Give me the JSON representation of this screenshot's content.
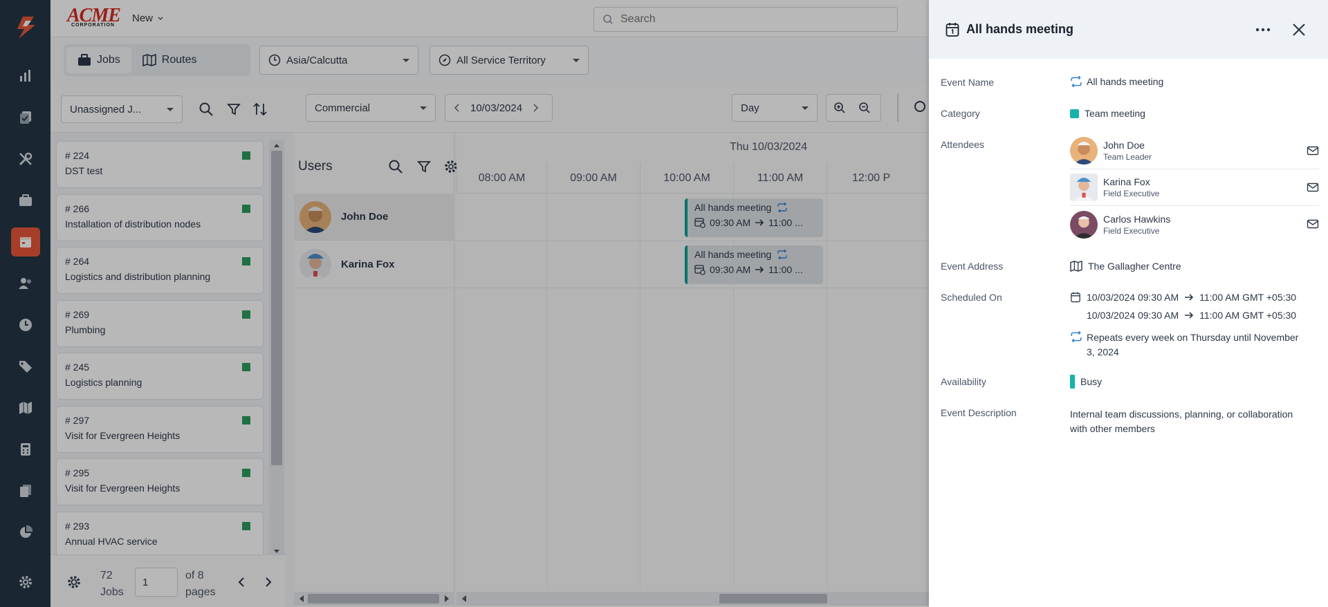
{
  "topbar": {
    "brand": "ACME",
    "brand_sub": "CORPORATION",
    "new_label": "New",
    "search_placeholder": "Search"
  },
  "toolbar": {
    "tabs": [
      {
        "label": "Jobs",
        "active": true
      },
      {
        "label": "Routes",
        "active": false
      }
    ],
    "timezone": "Asia/Calcutta",
    "territory": "All Service Territory",
    "job_filter": "Unassigned J...",
    "category_filter": "Commercial",
    "date": "10/03/2024",
    "view": "Day"
  },
  "jobs": [
    {
      "num": "# 224",
      "title": "DST test"
    },
    {
      "num": "# 266",
      "title": "Installation of distribution nodes"
    },
    {
      "num": "# 264",
      "title": "Logistics and distribution planning"
    },
    {
      "num": "# 269",
      "title": "Plumbing"
    },
    {
      "num": "# 245",
      "title": "Logistics planning"
    },
    {
      "num": "# 297",
      "title": "Visit for Evergreen Heights"
    },
    {
      "num": "# 295",
      "title": "Visit for Evergreen Heights"
    },
    {
      "num": "# 293",
      "title": "Annual HVAC service"
    }
  ],
  "jobs_footer": {
    "count": "72",
    "count_label": "Jobs",
    "page": "1",
    "of_label": "of 8",
    "pages_label": "pages"
  },
  "users": {
    "title": "Users",
    "list": [
      "John Doe",
      "Karina Fox"
    ]
  },
  "timeline": {
    "day_label": "Thu 10/03/2024",
    "hours": [
      "08:00 AM",
      "09:00 AM",
      "10:00 AM",
      "11:00 AM",
      "12:00 P"
    ],
    "events": [
      {
        "title": "All hands meeting",
        "start": "09:30 AM",
        "end": "11:00 ..."
      },
      {
        "title": "All hands meeting",
        "start": "09:30 AM",
        "end": "11:00 ..."
      }
    ]
  },
  "panel": {
    "title": "All hands meeting",
    "labels": {
      "event_name": "Event Name",
      "category": "Category",
      "attendees": "Attendees",
      "address": "Event Address",
      "scheduled": "Scheduled On",
      "availability": "Availability",
      "description": "Event Description"
    },
    "event_name": "All hands meeting",
    "category": "Team meeting",
    "attendees": [
      {
        "name": "John Doe",
        "role": "Team Leader"
      },
      {
        "name": "Karina Fox",
        "role": "Field Executive"
      },
      {
        "name": "Carlos Hawkins",
        "role": "Field Executive"
      }
    ],
    "address": "The Gallagher Centre",
    "schedule": [
      {
        "start": "10/03/2024 09:30 AM",
        "end": "11:00 AM GMT +05:30"
      },
      {
        "start": "10/03/2024 09:30 AM",
        "end": "11:00 AM GMT +05:30"
      }
    ],
    "repeats_line1": "Repeats every week on Thursday until November",
    "repeats_line2": "3, 2024",
    "availability": "Busy",
    "description_line1": "Internal team discussions, planning, or collaboration",
    "description_line2": "with other members"
  },
  "colors": {
    "nav_bg": "#243746",
    "nav_active": "#e8573a",
    "accent_teal": "#17b3aa",
    "job_status": "#2e9b5f",
    "repeat_icon": "#3182ce"
  }
}
